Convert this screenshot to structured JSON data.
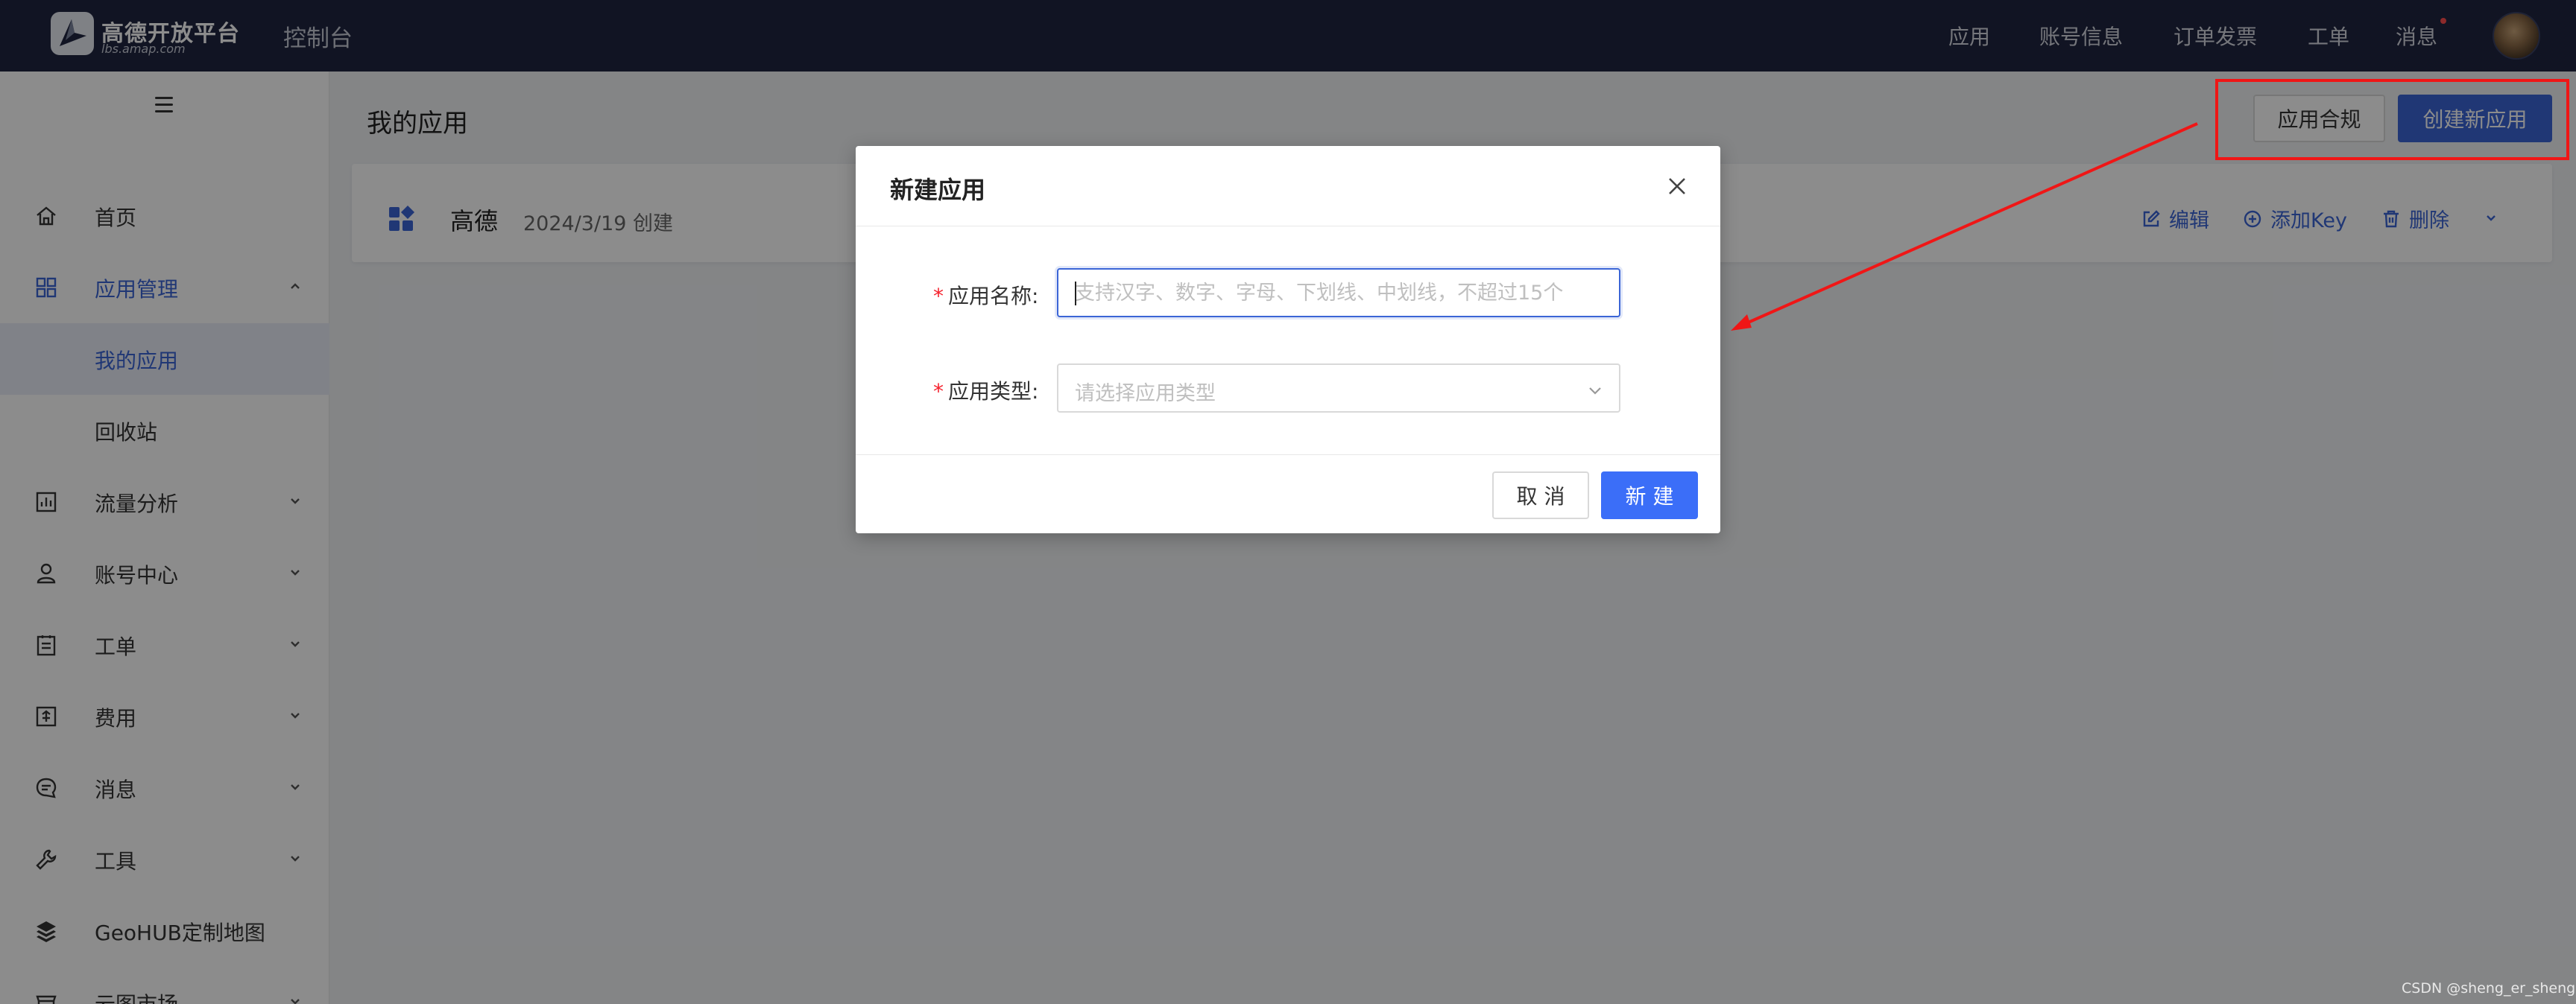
{
  "topbar": {
    "logo_name": "高德开放平台",
    "logo_url": "lbs.amap.com",
    "console_title": "控制台",
    "nav": [
      "应用",
      "账号信息",
      "订单发票",
      "工单",
      "消息"
    ]
  },
  "sidebar": {
    "items": [
      {
        "label": "首页",
        "icon": "home-icon"
      },
      {
        "label": "应用管理",
        "icon": "grid-icon",
        "expanded": true
      },
      {
        "label": "我的应用",
        "sub": true,
        "selected": true
      },
      {
        "label": "回收站",
        "sub": true
      },
      {
        "label": "流量分析",
        "icon": "chart-icon"
      },
      {
        "label": "账号中心",
        "icon": "user-icon"
      },
      {
        "label": "工单",
        "icon": "ticket-icon"
      },
      {
        "label": "费用",
        "icon": "billing-icon"
      },
      {
        "label": "消息",
        "icon": "message-icon"
      },
      {
        "label": "工具",
        "icon": "wrench-icon"
      },
      {
        "label": "GeoHUB定制地图",
        "icon": "layers-icon"
      },
      {
        "label": "云图市场",
        "icon": "store-icon"
      }
    ]
  },
  "main": {
    "title": "我的应用",
    "compliance_button": "应用合规",
    "create_button": "创建新应用",
    "app": {
      "name": "高德",
      "created": "2024/3/19 创建",
      "actions": [
        "编辑",
        "添加Key",
        "删除"
      ]
    }
  },
  "modal": {
    "title": "新建应用",
    "name_label": "应用名称:",
    "name_placeholder": "支持汉字、数字、字母、下划线、中划线，不超过15个",
    "type_label": "应用类型:",
    "type_placeholder": "请选择应用类型",
    "cancel": "取 消",
    "submit": "新 建"
  },
  "watermark": "CSDN @sheng_er_sheng",
  "colors": {
    "topbar": "#1f2541",
    "accent": "#3b65d6",
    "primary_button": "#3b6ef8",
    "annotation_red": "#f01616"
  }
}
